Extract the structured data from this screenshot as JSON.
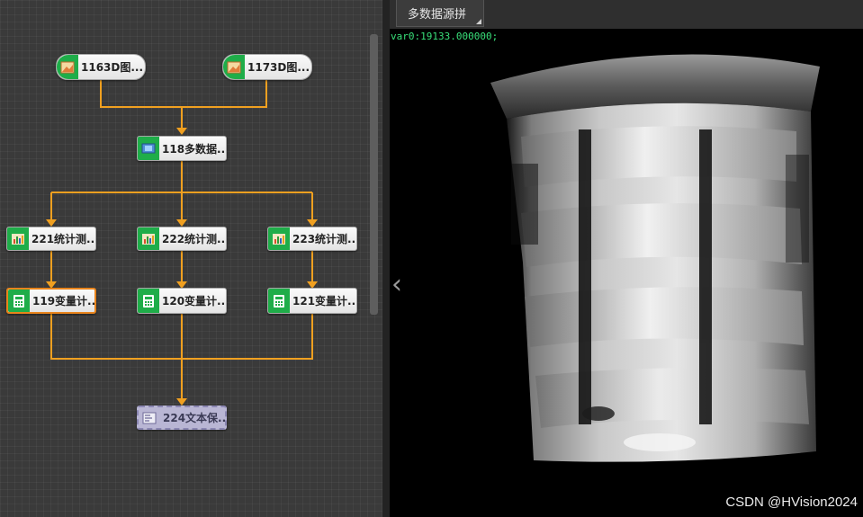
{
  "flow": {
    "nodes": {
      "n116": {
        "label": "1163D图..."
      },
      "n117": {
        "label": "1173D图..."
      },
      "n118": {
        "label": "118多数据..."
      },
      "n221": {
        "label": "221统计测..."
      },
      "n222": {
        "label": "222统计测..."
      },
      "n223": {
        "label": "223统计测..."
      },
      "n119": {
        "label": "119变量计..."
      },
      "n120": {
        "label": "120变量计..."
      },
      "n121": {
        "label": "121变量计..."
      },
      "n224": {
        "label": "224文本保..."
      }
    },
    "icons": {
      "image_3d": "image-3d-icon",
      "multi_source": "multi-source-icon",
      "stats": "stats-chart-icon",
      "calculator": "calculator-icon",
      "text_save": "text-save-icon"
    },
    "colors": {
      "wire": "#f0a020",
      "icon_bg": "#1fad49",
      "selected_border": "#e8841c"
    }
  },
  "viewer": {
    "tab_label": "多数据源拼",
    "readout": "var0:19133.000000;",
    "nav_prev": "‹",
    "watermark": "CSDN @HVision2024"
  }
}
